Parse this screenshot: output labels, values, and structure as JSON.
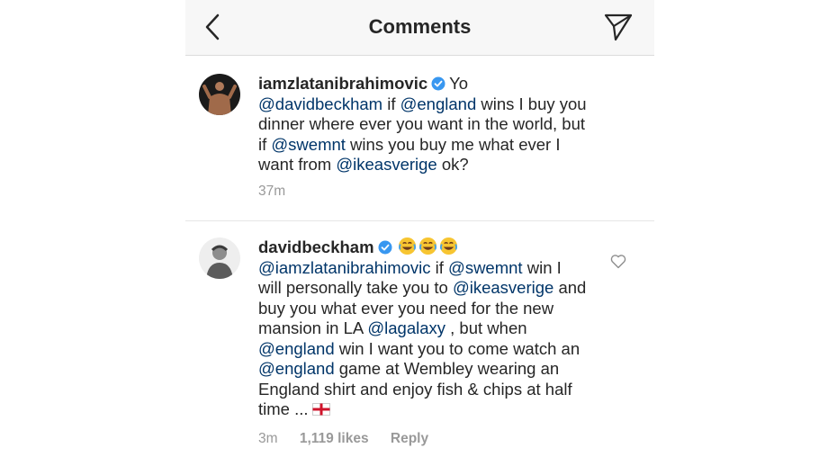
{
  "header": {
    "title": "Comments"
  },
  "comments": [
    {
      "username": "iamzlatanibrahimovic",
      "text": [
        {
          "t": "Yo "
        },
        {
          "t": "@davidbeckham",
          "mention": true
        },
        {
          "t": " if "
        },
        {
          "t": "@england",
          "mention": true
        },
        {
          "t": " wins I buy you dinner where ever you want in the world, but if "
        },
        {
          "t": "@swemnt",
          "mention": true
        },
        {
          "t": " wins you buy me what ever I want from "
        },
        {
          "t": "@ikeasverige",
          "mention": true
        },
        {
          "t": " ok?"
        }
      ],
      "time": "37m"
    },
    {
      "username": "davidbeckham",
      "emoji": [
        "face-with-tears-of-joy",
        "face-with-tears-of-joy",
        "face-with-tears-of-joy"
      ],
      "text": [
        {
          "t": "@iamzlatanibrahimovic",
          "mention": true
        },
        {
          "t": " if "
        },
        {
          "t": "@swemnt",
          "mention": true
        },
        {
          "t": " win I will personally take you to "
        },
        {
          "t": "@ikeasverige",
          "mention": true
        },
        {
          "t": " and buy you what ever you need for the new mansion in LA "
        },
        {
          "t": "@lagalaxy",
          "mention": true
        },
        {
          "t": " , but when "
        },
        {
          "t": "@england",
          "mention": true
        },
        {
          "t": " win I want you to come watch an "
        },
        {
          "t": "@england",
          "mention": true
        },
        {
          "t": " game at Wembley wearing an England shirt and enjoy fish & chips at half time ..."
        }
      ],
      "time": "3m",
      "likes": "1,119 likes",
      "reply": "Reply"
    }
  ],
  "colors": {
    "mention": "#003569",
    "meta": "#999999",
    "verified": "#3897f0"
  }
}
